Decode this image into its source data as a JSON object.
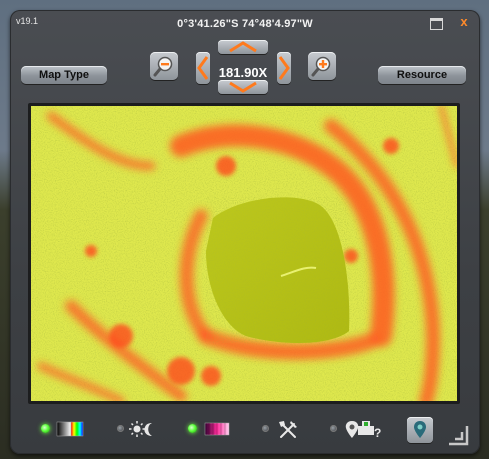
{
  "window": {
    "version": "v19.1",
    "coordinates": "0°3'41.26\"S 74°48'4.97\"W",
    "close_glyph": "x"
  },
  "toolbar": {
    "map_type_label": "Map Type",
    "resource_label": "Resource",
    "zoom_level": "181.90X"
  },
  "colors": {
    "accent_orange": "#ff8a2a",
    "led_on": "#5cff3a",
    "map_low": "#9aa60a",
    "map_mid": "#e8f060",
    "map_high": "#ff4a1c"
  },
  "bottom_bar": {
    "modes": [
      {
        "icon": "spectrum-icon",
        "active": true
      },
      {
        "icon": "day-night-icon",
        "active": false
      },
      {
        "icon": "slope-gradient-icon",
        "active": true
      },
      {
        "icon": "tools-icon",
        "active": false
      },
      {
        "icon": "biome-marker-icon",
        "active": false
      }
    ]
  }
}
